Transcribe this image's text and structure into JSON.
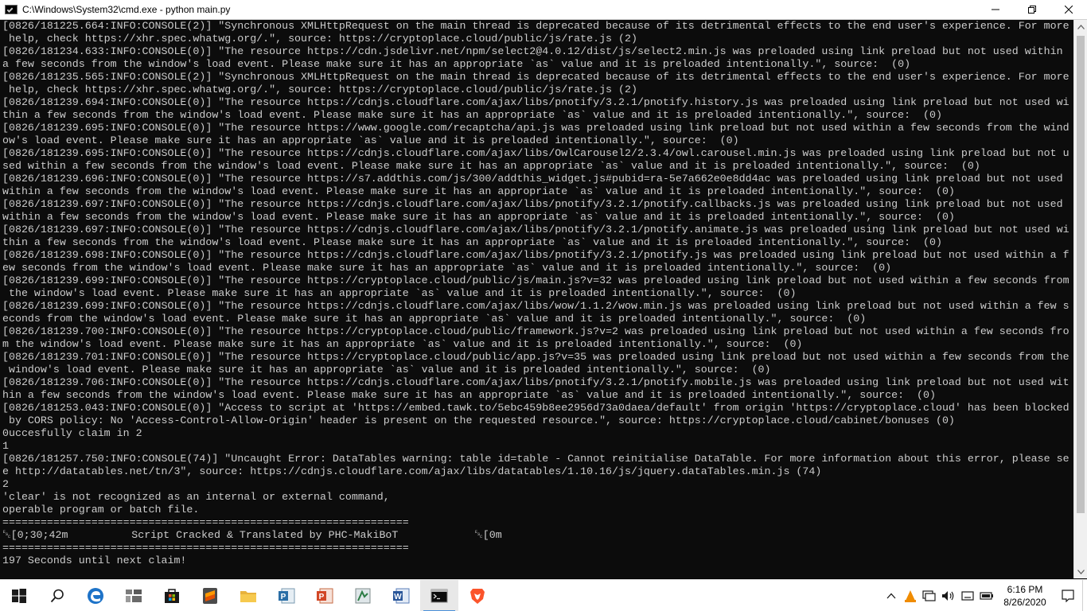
{
  "window": {
    "title": "C:\\Windows\\System32\\cmd.exe - python  main.py",
    "buttons": [
      "minimize",
      "maximize",
      "close"
    ]
  },
  "console": {
    "lines": [
      "[0826/181225.664:INFO:CONSOLE(2)] \"Synchronous XMLHttpRequest on the main thread is deprecated because of its detrimental effects to the end user's experience. For more",
      " help, check https://xhr.spec.whatwg.org/.\", source: https://cryptoplace.cloud/public/js/rate.js (2)",
      "[0826/181234.633:INFO:CONSOLE(0)] \"The resource https://cdn.jsdelivr.net/npm/select2@4.0.12/dist/js/select2.min.js was preloaded using link preload but not used within",
      "a few seconds from the window's load event. Please make sure it has an appropriate `as` value and it is preloaded intentionally.\", source:  (0)",
      "[0826/181235.565:INFO:CONSOLE(2)] \"Synchronous XMLHttpRequest on the main thread is deprecated because of its detrimental effects to the end user's experience. For more",
      " help, check https://xhr.spec.whatwg.org/.\", source: https://cryptoplace.cloud/public/js/rate.js (2)",
      "[0826/181239.694:INFO:CONSOLE(0)] \"The resource https://cdnjs.cloudflare.com/ajax/libs/pnotify/3.2.1/pnotify.history.js was preloaded using link preload but not used wi",
      "thin a few seconds from the window's load event. Please make sure it has an appropriate `as` value and it is preloaded intentionally.\", source:  (0)",
      "[0826/181239.695:INFO:CONSOLE(0)] \"The resource https://www.google.com/recaptcha/api.js was preloaded using link preload but not used within a few seconds from the wind",
      "ow's load event. Please make sure it has an appropriate `as` value and it is preloaded intentionally.\", source:  (0)",
      "[0826/181239.695:INFO:CONSOLE(0)] \"The resource https://cdnjs.cloudflare.com/ajax/libs/OwlCarousel2/2.3.4/owl.carousel.min.js was preloaded using link preload but not u",
      "sed within a few seconds from the window's load event. Please make sure it has an appropriate `as` value and it is preloaded intentionally.\", source:  (0)",
      "[0826/181239.696:INFO:CONSOLE(0)] \"The resource https://s7.addthis.com/js/300/addthis_widget.js#pubid=ra-5e7a662e0e8dd4ac was preloaded using link preload but not used",
      "within a few seconds from the window's load event. Please make sure it has an appropriate `as` value and it is preloaded intentionally.\", source:  (0)",
      "[0826/181239.697:INFO:CONSOLE(0)] \"The resource https://cdnjs.cloudflare.com/ajax/libs/pnotify/3.2.1/pnotify.callbacks.js was preloaded using link preload but not used",
      "within a few seconds from the window's load event. Please make sure it has an appropriate `as` value and it is preloaded intentionally.\", source:  (0)",
      "[0826/181239.697:INFO:CONSOLE(0)] \"The resource https://cdnjs.cloudflare.com/ajax/libs/pnotify/3.2.1/pnotify.animate.js was preloaded using link preload but not used wi",
      "thin a few seconds from the window's load event. Please make sure it has an appropriate `as` value and it is preloaded intentionally.\", source:  (0)",
      "[0826/181239.698:INFO:CONSOLE(0)] \"The resource https://cdnjs.cloudflare.com/ajax/libs/pnotify/3.2.1/pnotify.js was preloaded using link preload but not used within a f",
      "ew seconds from the window's load event. Please make sure it has an appropriate `as` value and it is preloaded intentionally.\", source:  (0)",
      "[0826/181239.699:INFO:CONSOLE(0)] \"The resource https://cryptoplace.cloud/public/js/main.js?v=32 was preloaded using link preload but not used within a few seconds from",
      " the window's load event. Please make sure it has an appropriate `as` value and it is preloaded intentionally.\", source:  (0)",
      "[0826/181239.699:INFO:CONSOLE(0)] \"The resource https://cdnjs.cloudflare.com/ajax/libs/wow/1.1.2/wow.min.js was preloaded using link preload but not used within a few s",
      "econds from the window's load event. Please make sure it has an appropriate `as` value and it is preloaded intentionally.\", source:  (0)",
      "[0826/181239.700:INFO:CONSOLE(0)] \"The resource https://cryptoplace.cloud/public/framework.js?v=2 was preloaded using link preload but not used within a few seconds fro",
      "m the window's load event. Please make sure it has an appropriate `as` value and it is preloaded intentionally.\", source:  (0)",
      "[0826/181239.701:INFO:CONSOLE(0)] \"The resource https://cryptoplace.cloud/public/app.js?v=35 was preloaded using link preload but not used within a few seconds from the",
      " window's load event. Please make sure it has an appropriate `as` value and it is preloaded intentionally.\", source:  (0)",
      "[0826/181239.706:INFO:CONSOLE(0)] \"The resource https://cdnjs.cloudflare.com/ajax/libs/pnotify/3.2.1/pnotify.mobile.js was preloaded using link preload but not used wit",
      "hin a few seconds from the window's load event. Please make sure it has an appropriate `as` value and it is preloaded intentionally.\", source:  (0)",
      "[0826/181253.043:INFO:CONSOLE(0)] \"Access to script at 'https://embed.tawk.to/5ebc459b8ee2956d73a0daea/default' from origin 'https://cryptoplace.cloud' has been blocked",
      " by CORS policy: No 'Access-Control-Allow-Origin' header is present on the requested resource.\", source: https://cryptoplace.cloud/cabinet/bonuses (0)",
      "0uccesfully claim in 2",
      "1",
      "[0826/181257.750:INFO:CONSOLE(74)] \"Uncaught Error: DataTables warning: table id=table - Cannot reinitialise DataTable. For more information about this error, please se",
      "e http://datatables.net/tn/3\", source: https://cdnjs.cloudflare.com/ajax/libs/datatables/1.10.16/js/jquery.dataTables.min.js (74)",
      "2",
      "'clear' is not recognized as an internal or external command,",
      "operable program or batch file.",
      "================================================================",
      "␛[0;30;42m          Script Cracked & Translated by PHC-MakiBoT            ␛[0m",
      "================================================================",
      "197 Seconds until next claim!"
    ]
  },
  "taskbar": {
    "items": [
      {
        "name": "start-button",
        "icon": "windows-logo-icon"
      },
      {
        "name": "search-button",
        "icon": "search-icon"
      },
      {
        "name": "edge-button",
        "icon": "edge-icon"
      },
      {
        "name": "task-view-button",
        "icon": "task-view-icon"
      },
      {
        "name": "store-button",
        "icon": "store-icon"
      },
      {
        "name": "sublime-button",
        "icon": "sublime-icon"
      },
      {
        "name": "file-explorer-button",
        "icon": "folder-icon"
      },
      {
        "name": "publisher-button",
        "icon": "publisher-icon"
      },
      {
        "name": "powerpoint-button",
        "icon": "powerpoint-icon"
      },
      {
        "name": "app-button",
        "icon": "app-icon"
      },
      {
        "name": "word-button",
        "icon": "word-icon"
      },
      {
        "name": "cmd-button",
        "icon": "cmd-icon"
      },
      {
        "name": "brave-button",
        "icon": "brave-icon"
      }
    ],
    "clock": {
      "time": "6:16 PM",
      "date": "8/26/2020"
    }
  },
  "colors": {
    "console_bg": "#0c0c0c",
    "console_text": "#cccccc",
    "titlebar_bg": "#ffffff",
    "taskbar_bg": "#ffffff",
    "accent": "#4a90d9"
  }
}
